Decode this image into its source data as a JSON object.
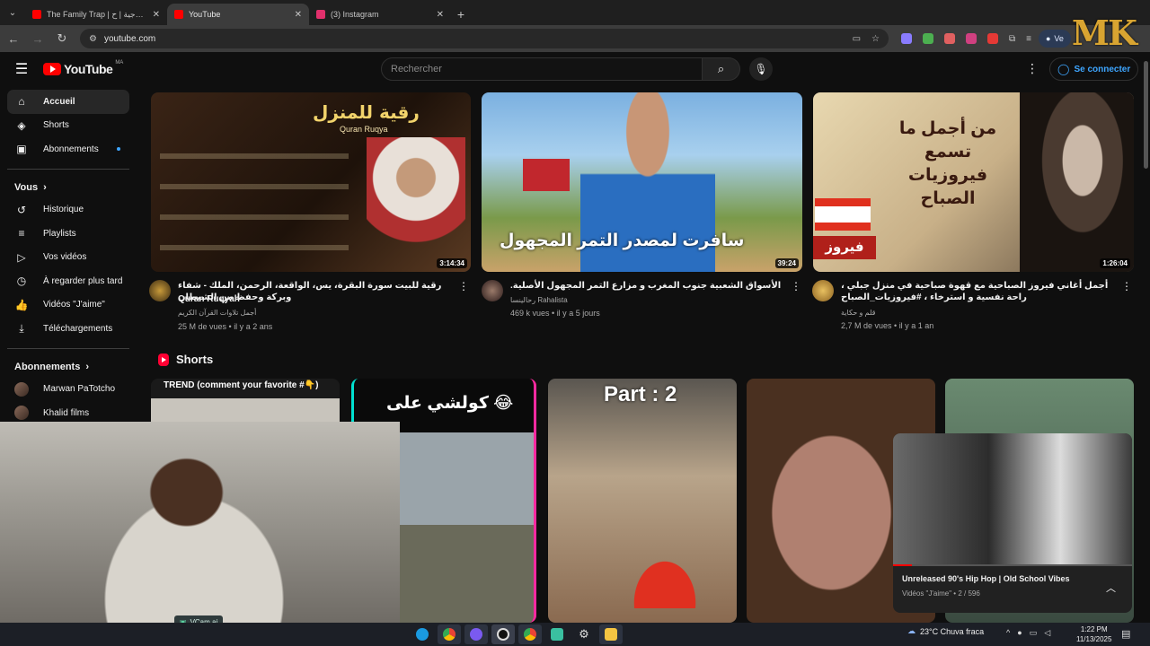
{
  "browser": {
    "tabs": [
      {
        "title": "The Family Trap | الكارما الزوجية | ح",
        "active": false,
        "favicon_color": "#ff0000"
      },
      {
        "title": "YouTube",
        "active": true,
        "favicon_color": "#ff0000"
      },
      {
        "title": "(3) Instagram",
        "active": false,
        "favicon_color": "#e1306c"
      }
    ],
    "url": "youtube.com",
    "profile_label": "Ve"
  },
  "watermark": "MK",
  "youtube": {
    "logo_text": "YouTube",
    "country_code": "MA",
    "search_placeholder": "Rechercher",
    "signin_label": "Se connecter"
  },
  "sidebar": {
    "items": [
      {
        "label": "Accueil",
        "icon": "home-icon",
        "active": true
      },
      {
        "label": "Shorts",
        "icon": "shorts-icon"
      },
      {
        "label": "Abonnements",
        "icon": "subscriptions-icon",
        "dot": true
      }
    ],
    "you_header": "Vous",
    "you_items": [
      {
        "label": "Historique",
        "icon": "history-icon"
      },
      {
        "label": "Playlists",
        "icon": "playlists-icon"
      },
      {
        "label": "Vos vidéos",
        "icon": "your-videos-icon"
      },
      {
        "label": "À regarder plus tard",
        "icon": "watch-later-icon"
      },
      {
        "label": "Vidéos \"J'aime\"",
        "icon": "liked-icon"
      },
      {
        "label": "Téléchargements",
        "icon": "downloads-icon"
      }
    ],
    "subs_header": "Abonnements",
    "subs": [
      {
        "label": "Marwan PaTotcho"
      },
      {
        "label": "Khalid films"
      }
    ]
  },
  "videos": [
    {
      "title": "رقية للبيت سورة البقرة، يس، الواقعة، الرحمن، الملك - شفاء وبركة وحفظ من الشيطان",
      "channel": "Quran Ruqyah",
      "channel_sub": "أجمل تلاوات القرآن الكريم",
      "views": "25 M de vues",
      "age": "il y a 2 ans",
      "duration": "3:14:34",
      "thumb_text": "رقية للمنزل",
      "thumb_sub": "Quran Ruqya"
    },
    {
      "title": "الأسواق الشعبية جنوب المغرب و مزارع التمر المجهول الأصلية.",
      "channel": "رحالينسا Rahalista",
      "views": "469 k vues",
      "age": "il y a 5 jours",
      "duration": "39:24",
      "thumb_text": "سافرت لمصدر التمر المجهول"
    },
    {
      "title": "أجمل أغاني فيروز الصباحية مع قهوة صباحية في منزل جبلي ، راحة نفسية و استرخاء ، #فيروزيات_الصباح",
      "channel": "قلم و حكاية",
      "views": "2,7 M de vues",
      "age": "il y a 1 an",
      "duration": "1:26:04",
      "thumb_text": "من أجمل ما تسمع فيروزيات الصباح",
      "thumb_tag": "فيروز"
    }
  ],
  "shorts": {
    "header": "Shorts",
    "items": [
      {
        "overlay": "TREND (comment your favorite #👇)"
      },
      {
        "overlay": "كولشي على 😂"
      },
      {
        "overlay": "Part : 2"
      },
      {
        "overlay": ""
      },
      {
        "overlay": ""
      }
    ]
  },
  "webcam": {
    "badge": "VCam.ai"
  },
  "miniplayer": {
    "title": "Unreleased 90's Hip Hop | Old School Vibes",
    "subtitle": "Vidéos \"J'aime\" • 2 / 596",
    "progress": 0.08
  },
  "taskbar": {
    "weather": "23°C  Chuva fraca",
    "time": "1:22 PM",
    "date": "11/13/2025"
  }
}
